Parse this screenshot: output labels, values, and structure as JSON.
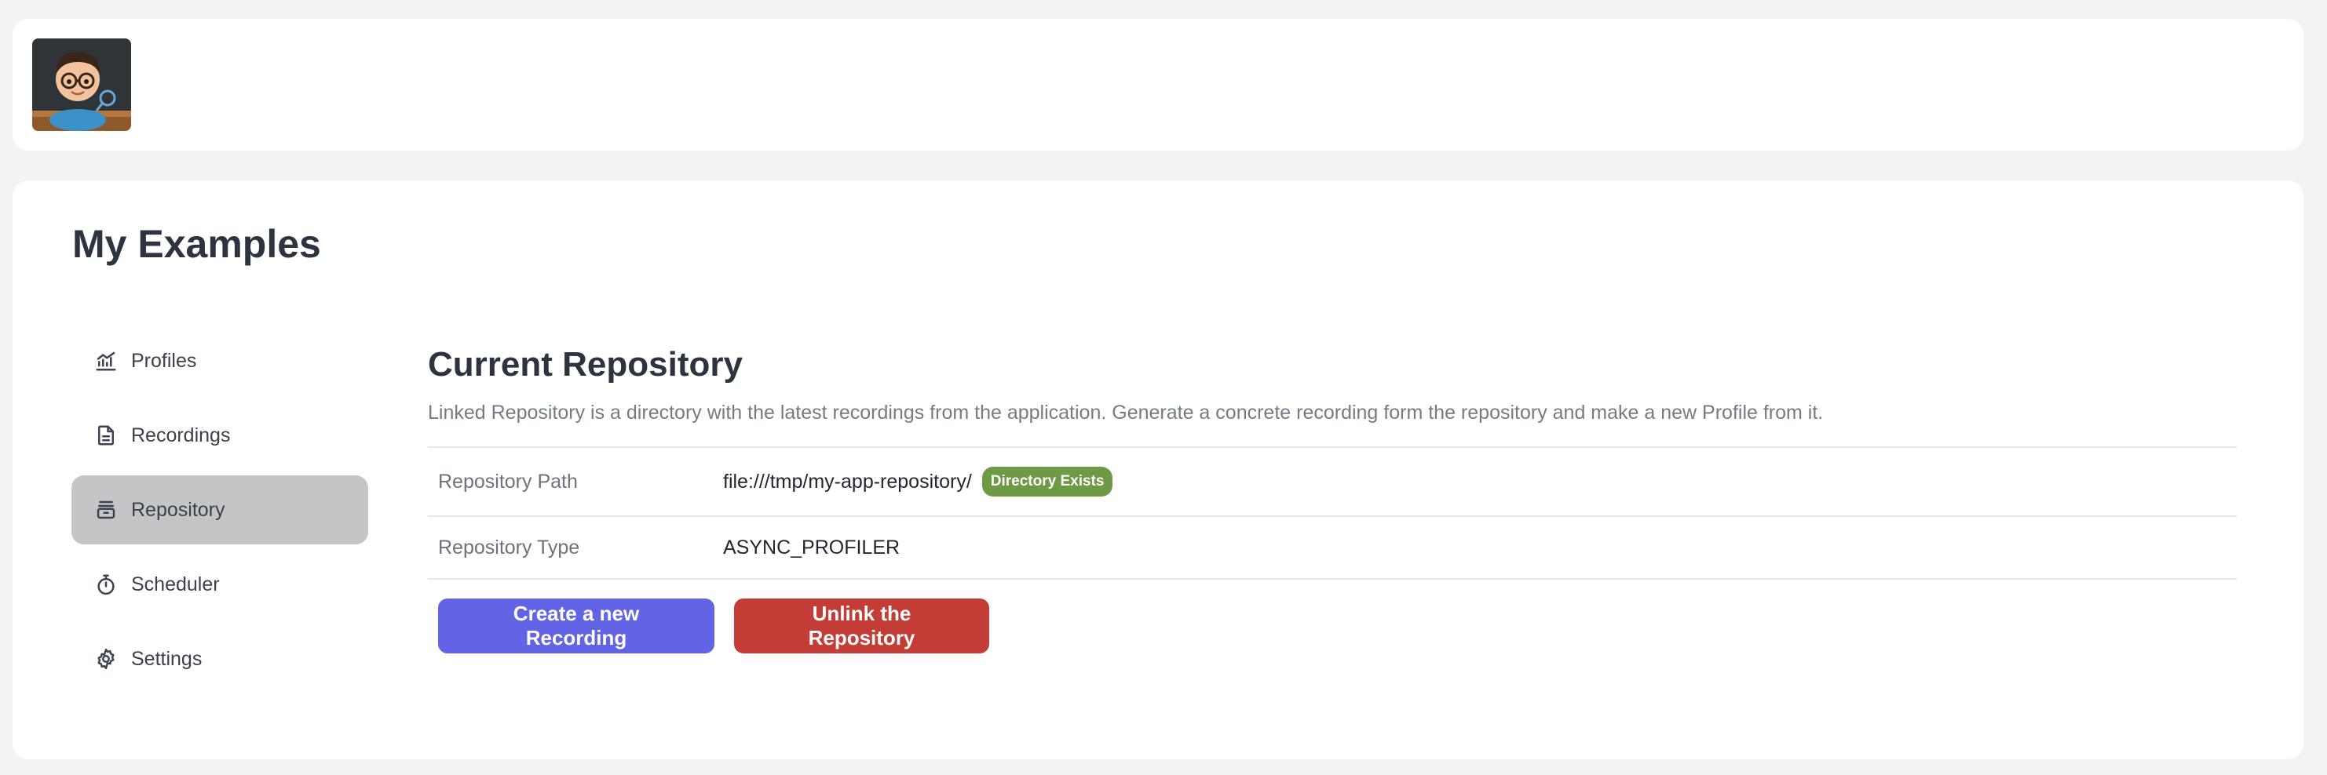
{
  "header": {
    "logo_icon": "developer-avatar-logo"
  },
  "page": {
    "title": "My Examples"
  },
  "sidebar": {
    "items": [
      {
        "label": "Profiles",
        "icon": "chart-icon",
        "active": false
      },
      {
        "label": "Recordings",
        "icon": "document-icon",
        "active": false
      },
      {
        "label": "Repository",
        "icon": "archive-icon",
        "active": true
      },
      {
        "label": "Scheduler",
        "icon": "timer-icon",
        "active": false
      },
      {
        "label": "Settings",
        "icon": "gear-icon",
        "active": false
      }
    ]
  },
  "repository": {
    "title": "Current Repository",
    "description": "Linked Repository is a directory with the latest recordings from the application. Generate a concrete recording form the repository and make a new Profile from it.",
    "rows": [
      {
        "key": "Repository Path",
        "value": "file:///tmp/my-app-repository/",
        "badge": "Directory Exists"
      },
      {
        "key": "Repository Type",
        "value": "ASYNC_PROFILER"
      }
    ],
    "create_button": "Create a new Recording",
    "unlink_button": "Unlink the Repository"
  },
  "colors": {
    "active_nav": "#c4c5c6",
    "badge_green": "#6e9a45",
    "primary_button": "#6363e6",
    "danger_button": "#c43c36"
  }
}
